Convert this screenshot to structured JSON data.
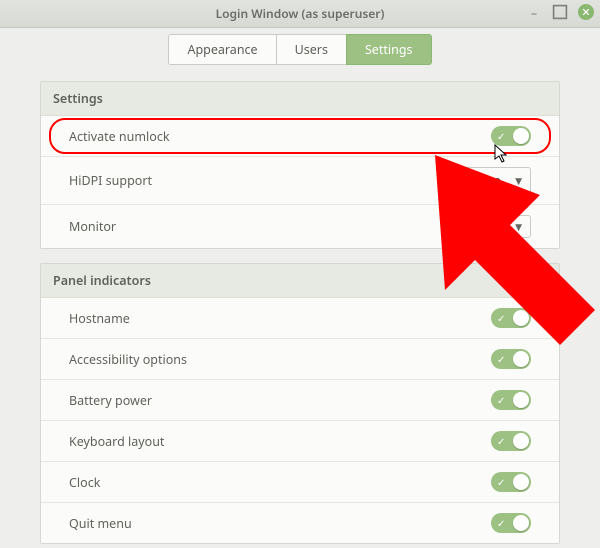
{
  "window_title": "Login Window (as superuser)",
  "tabs": {
    "appearance": "Appearance",
    "users": "Users",
    "settings": "Settings",
    "active": "settings"
  },
  "panel_settings_title": "Settings",
  "rows_settings": {
    "numlock": {
      "label": "Activate numlock",
      "on": true
    },
    "hidpi": {
      "label": "HiDPI support",
      "value": "Auto"
    },
    "monitor": {
      "label": "Monitor",
      "value": ""
    }
  },
  "panel_indicators_title": "Panel indicators",
  "rows_indicators": {
    "hostname": {
      "label": "Hostname",
      "on": true
    },
    "a11y": {
      "label": "Accessibility options",
      "on": true
    },
    "battery": {
      "label": "Battery power",
      "on": true
    },
    "keyboard": {
      "label": "Keyboard layout",
      "on": true
    },
    "clock": {
      "label": "Clock",
      "on": true
    },
    "quit": {
      "label": "Quit menu",
      "on": true
    }
  },
  "colors": {
    "accent": "#9cc183",
    "annotation": "#ff0000"
  }
}
